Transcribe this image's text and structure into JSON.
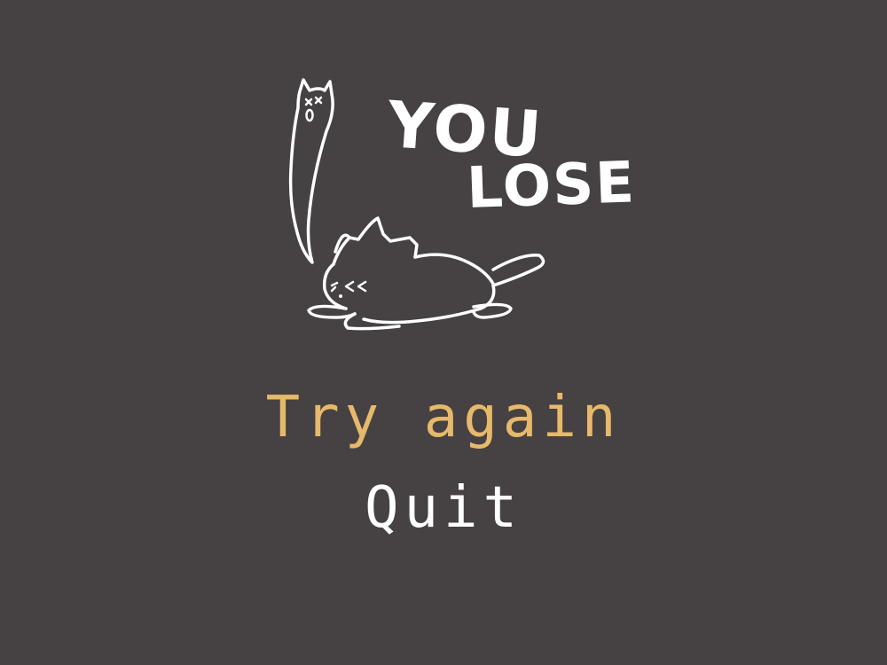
{
  "title": {
    "line1": "YOU",
    "line2": "LOSE"
  },
  "menu": {
    "options": [
      {
        "label": "Try again",
        "selected": true
      },
      {
        "label": "Quit",
        "selected": false
      }
    ]
  },
  "colors": {
    "background": "#464142",
    "text": "#ffffff",
    "selected": "#e7b96b"
  },
  "illustration": {
    "subject": "defeated-cat-with-ghost"
  }
}
